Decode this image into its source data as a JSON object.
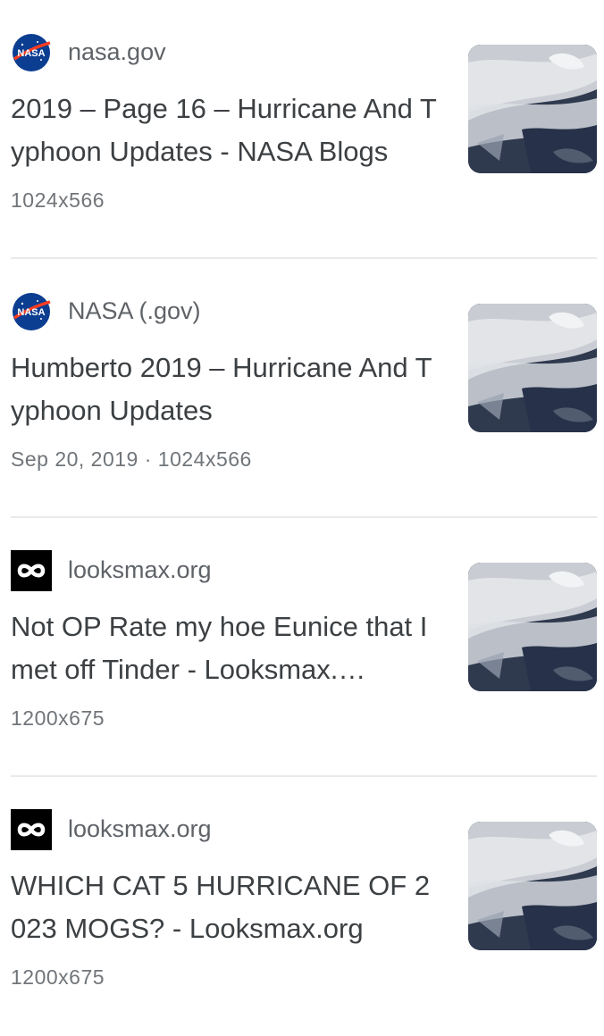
{
  "results": [
    {
      "source": "nasa.gov",
      "favicon": "nasa-logo-icon",
      "title": "2019 – Page 16 – Hurricane And Typhoon Updates - NASA Blogs",
      "meta": "1024x566",
      "thumbnail": "satellite-cloud-image"
    },
    {
      "source": "NASA (.gov)",
      "favicon": "nasa-logo-icon",
      "title": "Humberto 2019 – Hurricane And Typhoon Updates",
      "meta": "Sep 20, 2019 · 1024x566",
      "thumbnail": "satellite-cloud-image"
    },
    {
      "source": "looksmax.org",
      "favicon": "looksmax-logo-icon",
      "title": "Not OP Rate my hoe Eunice that I met off Tinder - Looksmax.…",
      "meta": "1200x675",
      "thumbnail": "satellite-cloud-image"
    },
    {
      "source": "looksmax.org",
      "favicon": "looksmax-logo-icon",
      "title": "WHICH CAT 5 HURRICANE OF 2023 MOGS? - Looksmax.org",
      "meta": "1200x675",
      "thumbnail": "satellite-cloud-image"
    }
  ],
  "colors": {
    "text": "#3c4043",
    "secondary": "#5f6368",
    "meta": "#70757a",
    "divider": "#e8eaed",
    "nasa_blue": "#0b3d91",
    "nasa_red": "#fc3d21"
  }
}
